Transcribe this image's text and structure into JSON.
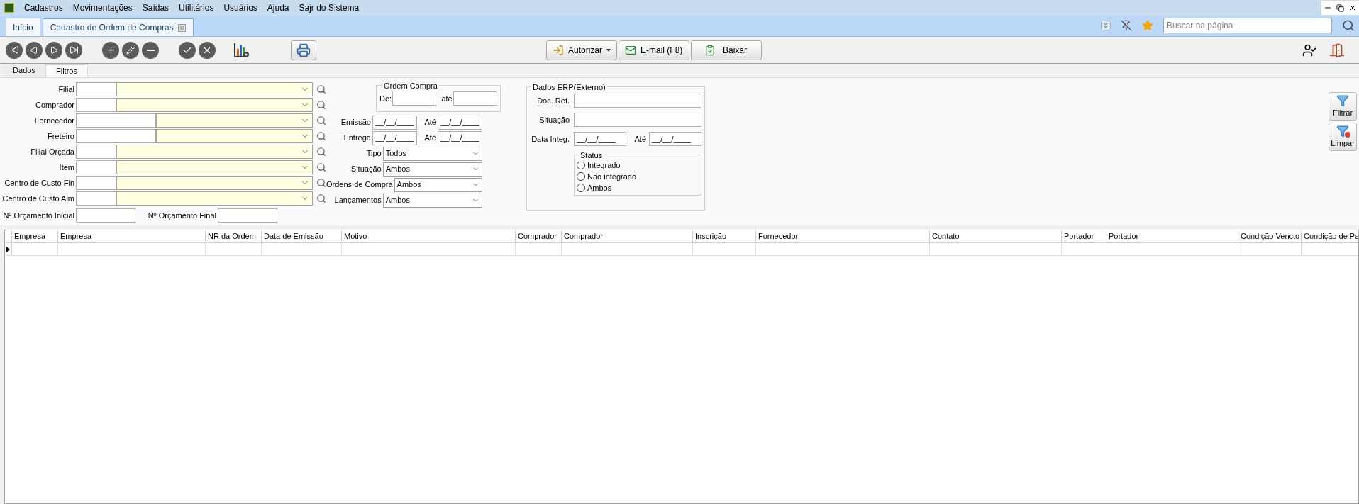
{
  "menu": [
    "Cadastros",
    "Movimentações",
    "Saídas",
    "Utilitários",
    "Usuários",
    "Ajuda",
    "Sajr do Sistema"
  ],
  "tabs": [
    {
      "label": "Início",
      "selected": false
    },
    {
      "label": "Cadastro de Ordem de Compras",
      "selected": true
    }
  ],
  "search": {
    "placeholder": "Buscar na página"
  },
  "toolbar": {
    "authorize": "Autorizar",
    "email": "E-mail (F8)",
    "download": "Baixar"
  },
  "form_tabs": [
    {
      "label": "Dados",
      "selected": false
    },
    {
      "label": "Filtros",
      "selected": true
    }
  ],
  "filters": [
    {
      "label": "Filial",
      "kind": "short"
    },
    {
      "label": "Comprador",
      "kind": "short"
    },
    {
      "label": "Fornecedor",
      "kind": "long"
    },
    {
      "label": "Freteiro",
      "kind": "long"
    },
    {
      "label": "Filial Orçada",
      "kind": "short"
    },
    {
      "label": "Item",
      "kind": "short"
    },
    {
      "label": "Centro de Custo Fin",
      "kind": "short"
    },
    {
      "label": "Centro de Custo Alm",
      "kind": "short"
    }
  ],
  "budget": {
    "from_label": "Nº Orçamento Inicial",
    "to_label": "Nº Orçamento Final"
  },
  "order_group": {
    "title": "Ordem Compra",
    "from_label": "De:",
    "to_label": "até"
  },
  "dates": [
    {
      "label": "Emissão",
      "from": "__/__/____",
      "to_label": "Até",
      "to": "__/__/____"
    },
    {
      "label": "Entrega",
      "from": "__/__/____",
      "to_label": "Até",
      "to": "__/__/____"
    }
  ],
  "selects": [
    {
      "label": "Tipo",
      "value": "Todos"
    },
    {
      "label": "Situação",
      "value": "Ambos"
    },
    {
      "label": "Ordens de Compra",
      "value": "Ambos"
    },
    {
      "label": "Lançamentos",
      "value": "Ambos"
    }
  ],
  "erp": {
    "title": "Dados ERP(Externo)",
    "doc_ref_label": "Doc. Ref.",
    "situation_label": "Situação",
    "date_label": "Data Integ.",
    "date_from": "__/__/____",
    "to_label": "Até",
    "date_to": "__/__/____",
    "status_title": "Status",
    "status_options": [
      {
        "label": "Integrado",
        "selected": false
      },
      {
        "label": "Não integrado",
        "selected": false
      },
      {
        "label": "Ambos",
        "selected": false
      }
    ]
  },
  "side_buttons": [
    {
      "label": "Filtrar",
      "kind": "filter"
    },
    {
      "label": "Limpar",
      "kind": "clear"
    }
  ],
  "table": {
    "columns": [
      "Empresa",
      "Empresa",
      "NR da Ordem",
      "Data de Emissão",
      "Motivo",
      "Comprador",
      "Comprador",
      "Inscrição",
      "Fornecedor",
      "Contato",
      "Portador",
      "Portador",
      "Condição Vencto",
      "Condição de Pa"
    ],
    "current_row": true
  }
}
